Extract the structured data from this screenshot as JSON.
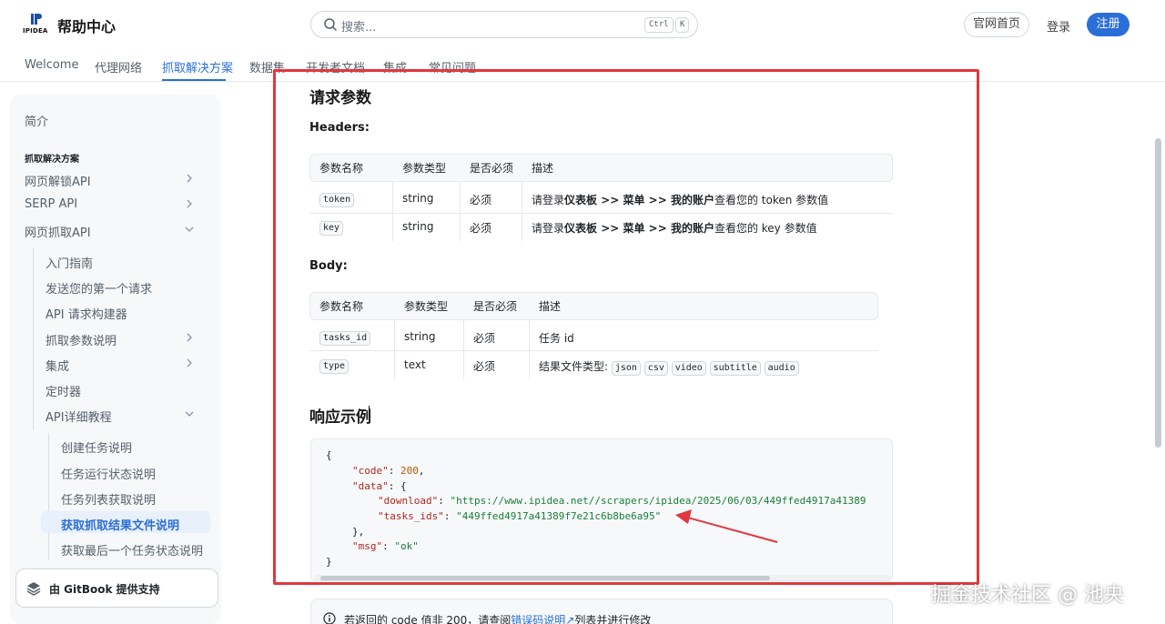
{
  "header": {
    "logo_text": "IPIDEA",
    "site_title": "帮助中心",
    "search_placeholder": "搜索...",
    "kbd_ctrl": "Ctrl",
    "kbd_k": "K",
    "home_button": "官网首页",
    "login": "登录",
    "register": "注册"
  },
  "tabs": [
    "Welcome",
    "代理网络",
    "抓取解决方案",
    "数据集",
    "开发者文档",
    "集成",
    "常见问题"
  ],
  "sidebar": {
    "intro": "简介",
    "section": "抓取解决方案",
    "items": {
      "unlock_api": "网页解锁API",
      "serp_api": "SERP API",
      "scrape_api": "网页抓取API",
      "getting_started": "入门指南",
      "first_request": "发送您的第一个请求",
      "api_builder": "API 请求构建器",
      "params": "抓取参数说明",
      "integration": "集成",
      "timer": "定时器",
      "api_tutorial": "API详细教程",
      "create_task": "创建任务说明",
      "task_status": "任务运行状态说明",
      "task_list": "任务列表获取说明",
      "get_result": "获取抓取结果文件说明",
      "last_status": "获取最后一个任务状态说明"
    },
    "gitbook": "由 GitBook 提供支持"
  },
  "content": {
    "title_params": "请求参数",
    "headers_label": "Headers:",
    "headers_table": {
      "columns": [
        "参数名称",
        "参数类型",
        "是否必须",
        "描述"
      ],
      "rows": [
        {
          "name": "token",
          "type": "string",
          "required": "必须",
          "desc_pre": "请登录",
          "desc_bold": "仪表板 >> 菜单 >> 我的账户",
          "desc_post": "查看您的 token 参数值"
        },
        {
          "name": "key",
          "type": "string",
          "required": "必须",
          "desc_pre": "请登录",
          "desc_bold": "仪表板 >> 菜单 >> 我的账户",
          "desc_post": "查看您的 key 参数值"
        }
      ]
    },
    "body_label": "Body:",
    "body_table": {
      "columns": [
        "参数名称",
        "参数类型",
        "是否必须",
        "描述"
      ],
      "rows": [
        {
          "name": "tasks_id",
          "type": "string",
          "required": "必须",
          "desc": "任务 id"
        },
        {
          "name": "type",
          "type": "text",
          "required": "必须",
          "desc": "结果文件类型:",
          "formats": [
            "json",
            "csv",
            "video",
            "subtitle",
            "audio"
          ]
        }
      ]
    },
    "title_response": "响应示例",
    "code": {
      "brace_open": "{",
      "code_key": "\"code\"",
      "code_val": "200",
      "data_key": "\"data\"",
      "download_key": "\"download\"",
      "download_val": "\"https://www.ipidea.net//scrapers/ipidea/2025/06/03/449ffed4917a41389",
      "tasks_ids_key": "\"tasks_ids\"",
      "tasks_ids_val": "\"449ffed4917a41389f7e21c6b8be6a95\"",
      "inner_close": "},",
      "msg_key": "\"msg\"",
      "msg_val": "\"ok\"",
      "brace_close": "}"
    },
    "hint_pre": "若返回的 code 值非 200，请查阅",
    "hint_link": "错误码说明",
    "hint_post": "列表并进行修改"
  },
  "watermark": "掘金技术社区 @ 池央",
  "colors": {
    "accent": "#2b6fd6",
    "annotation_red": "#e0383e"
  }
}
